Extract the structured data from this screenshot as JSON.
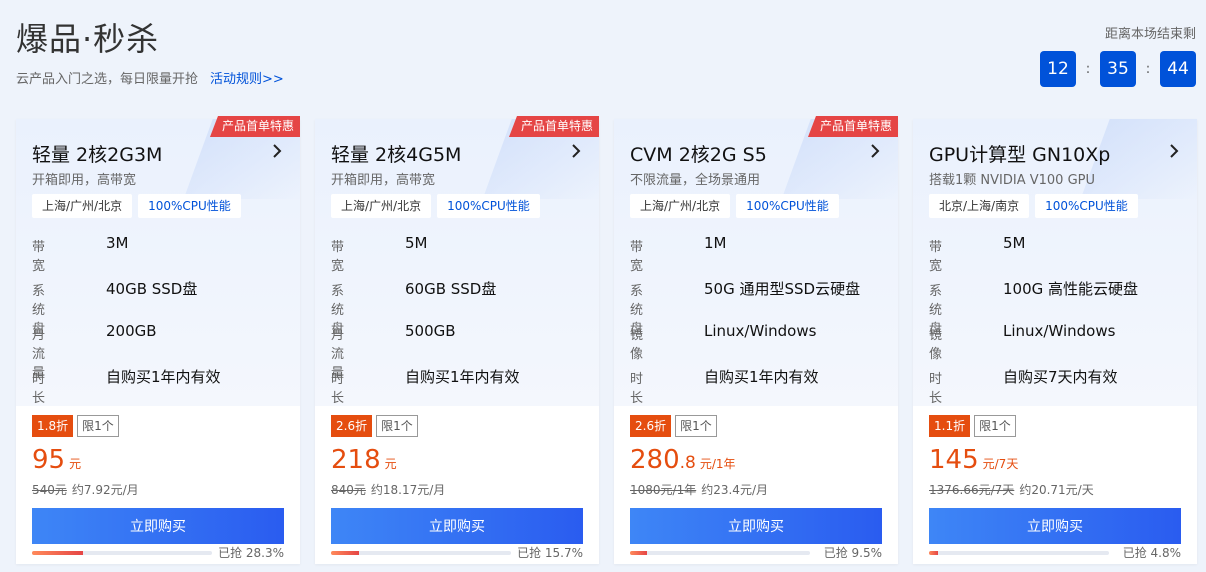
{
  "header": {
    "title": "爆品·秒杀",
    "subtitle": "云产品入门之选，每日限量开抢",
    "rules_link": "活动规则>>",
    "countdown_label": "距离本场结束剩",
    "countdown": {
      "hours": "12",
      "minutes": "35",
      "seconds": "44",
      "separator": ":"
    }
  },
  "colors": {
    "accent": "#0052d9",
    "price": "#e54d0f",
    "ribbon": "#e54545"
  },
  "cards": [
    {
      "ribbon": "产品首单特惠",
      "name": "轻量 2核2G3M",
      "desc": "开箱即用，高带宽",
      "tags": [
        "上海/广州/北京",
        "100%CPU性能"
      ],
      "specs": [
        {
          "key": "带宽",
          "value": "3M"
        },
        {
          "key": "系统盘",
          "value": "40GB SSD盘"
        },
        {
          "key": "月流量",
          "value": "200GB"
        },
        {
          "key": "时长",
          "value": "自购买1年内有效"
        }
      ],
      "discount": "1.8折",
      "limit": "限1个",
      "price_int": "95",
      "price_dec": "",
      "price_unit": "元",
      "orig_price": "540元",
      "monthly": "约7.92元/月",
      "buy_label": "立即购买",
      "progress_label": "已抢 28.3%",
      "progress": 28.3
    },
    {
      "ribbon": "产品首单特惠",
      "name": "轻量 2核4G5M",
      "desc": "开箱即用，高带宽",
      "tags": [
        "上海/广州/北京",
        "100%CPU性能"
      ],
      "specs": [
        {
          "key": "带宽",
          "value": "5M"
        },
        {
          "key": "系统盘",
          "value": "60GB SSD盘"
        },
        {
          "key": "月流量",
          "value": "500GB"
        },
        {
          "key": "时长",
          "value": "自购买1年内有效"
        }
      ],
      "discount": "2.6折",
      "limit": "限1个",
      "price_int": "218",
      "price_dec": "",
      "price_unit": "元",
      "orig_price": "840元",
      "monthly": "约18.17元/月",
      "buy_label": "立即购买",
      "progress_label": "已抢 15.7%",
      "progress": 15.7
    },
    {
      "ribbon": "产品首单特惠",
      "name": "CVM 2核2G S5",
      "desc": "不限流量，全场景通用",
      "tags": [
        "上海/广州/北京",
        "100%CPU性能"
      ],
      "specs": [
        {
          "key": "带宽",
          "value": "1M"
        },
        {
          "key": "系统盘",
          "value": "50G 通用型SSD云硬盘"
        },
        {
          "key": "镜像",
          "value": "Linux/Windows"
        },
        {
          "key": "时长",
          "value": "自购买1年内有效"
        }
      ],
      "discount": "2.6折",
      "limit": "限1个",
      "price_int": "280",
      "price_dec": ".8",
      "price_unit": "元/1年",
      "orig_price": "1080元/1年",
      "monthly": "约23.4元/月",
      "buy_label": "立即购买",
      "progress_label": "已抢 9.5%",
      "progress": 9.5
    },
    {
      "ribbon": "",
      "name": "GPU计算型 GN10Xp",
      "desc": "搭载1颗 NVIDIA V100 GPU",
      "tags": [
        "北京/上海/南京",
        "100%CPU性能"
      ],
      "specs": [
        {
          "key": "带宽",
          "value": "5M"
        },
        {
          "key": "系统盘",
          "value": "100G 高性能云硬盘"
        },
        {
          "key": "镜像",
          "value": "Linux/Windows"
        },
        {
          "key": "时长",
          "value": "自购买7天内有效"
        }
      ],
      "discount": "1.1折",
      "limit": "限1个",
      "price_int": "145",
      "price_dec": "",
      "price_unit": "元/7天",
      "orig_price": "1376.66元/7天",
      "monthly": "约20.71元/天",
      "buy_label": "立即购买",
      "progress_label": "已抢 4.8%",
      "progress": 4.8
    }
  ]
}
